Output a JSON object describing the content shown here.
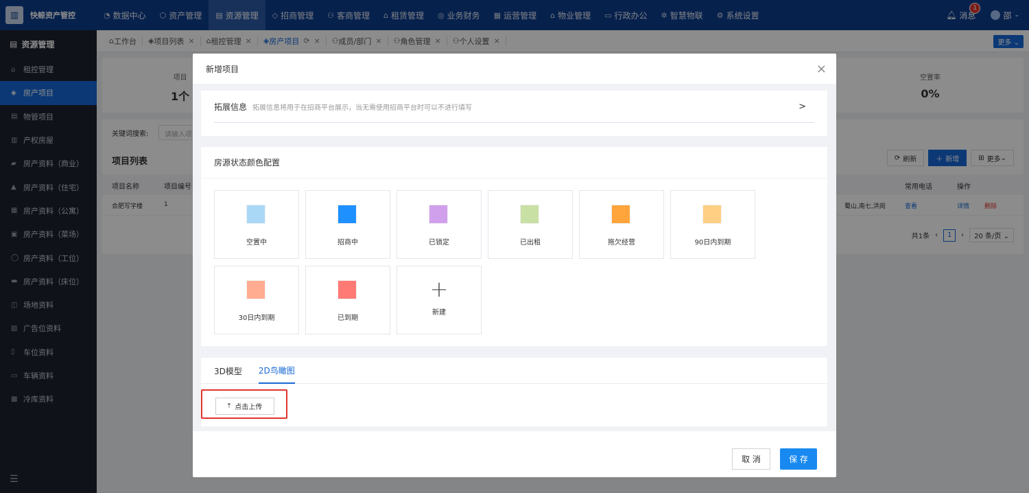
{
  "app": {
    "logo_glyph": "▥",
    "name": "快鲸资产管控"
  },
  "topnav": [
    {
      "icon": "◔",
      "label": "数据中心"
    },
    {
      "icon": "⬡",
      "label": "资产管理"
    },
    {
      "icon": "▤",
      "label": "资源管理",
      "active": true
    },
    {
      "icon": "◇",
      "label": "招商管理"
    },
    {
      "icon": "⚇",
      "label": "客商管理"
    },
    {
      "icon": "⌂",
      "label": "租赁管理"
    },
    {
      "icon": "◎",
      "label": "业务财务"
    },
    {
      "icon": "▦",
      "label": "运营管理"
    },
    {
      "icon": "⌂",
      "label": "物业管理"
    },
    {
      "icon": "▭",
      "label": "行政办公"
    },
    {
      "icon": "✲",
      "label": "智慧物联"
    },
    {
      "icon": "⚙",
      "label": "系统设置"
    }
  ],
  "header_right": {
    "messages_label": "消息",
    "messages_badge": "1",
    "user_name": "邵"
  },
  "sidebar": {
    "title": "资源管理",
    "items": [
      {
        "label": "租控管理"
      },
      {
        "label": "房产项目",
        "active": true
      },
      {
        "label": "物管项目"
      },
      {
        "label": "产权房屋"
      },
      {
        "label": "房产资料（商业）"
      },
      {
        "label": "房产资料（住宅）"
      },
      {
        "label": "房产资料（公寓）"
      },
      {
        "label": "房产资料（菜场）"
      },
      {
        "label": "房产资料（工位）"
      },
      {
        "label": "房产资料（床位）"
      },
      {
        "label": "场地资料"
      },
      {
        "label": "广告位资料"
      },
      {
        "label": "车位资料"
      },
      {
        "label": "车辆资料"
      },
      {
        "label": "冷库资料"
      }
    ]
  },
  "tabs": [
    {
      "label": "工作台",
      "closable": false
    },
    {
      "label": "项目列表",
      "closable": true
    },
    {
      "label": "租控管理",
      "closable": true
    },
    {
      "label": "房产项目",
      "closable": true,
      "active": true
    },
    {
      "label": "成员/部门",
      "closable": true
    },
    {
      "label": "角色管理",
      "closable": true
    },
    {
      "label": "个人设置",
      "closable": true
    }
  ],
  "more_label": "更多",
  "background": {
    "stat_left_label": "项目",
    "stat_left_value": "1个",
    "stat_right_label": "空置率",
    "stat_right_value": "0%",
    "keyword_label": "关键词搜索:",
    "keyword_placeholder": "请输入项",
    "list_title": "项目列表",
    "btn_refresh": "刷新",
    "btn_add": "新增",
    "btn_more": "更多",
    "col_name": "项目名称",
    "col_code": "项目编号",
    "col_phone": "常用电话",
    "col_ops": "操作",
    "row_name": "合肥写字楼",
    "row_code": "1",
    "row_addr": "蜀山,南七,洪岗",
    "row_view": "查看",
    "row_detail": "详情",
    "row_delete": "删除",
    "total": "共1条",
    "page": "1",
    "page_size": "20 条/页"
  },
  "modal": {
    "title": "新增项目",
    "ext_title": "拓展信息",
    "ext_desc": "拓展信息将用于在招商平台展示，当无需使用招商平台时可以不进行填写",
    "colors_title": "房源状态颜色配置",
    "statuses": [
      {
        "label": "空置中",
        "color": "#a9d8f7"
      },
      {
        "label": "招商中",
        "color": "#1e90ff"
      },
      {
        "label": "已锁定",
        "color": "#d1a0ec"
      },
      {
        "label": "已出租",
        "color": "#c9e0a4"
      },
      {
        "label": "拖欠经营",
        "color": "#ffa53c"
      },
      {
        "label": "90日内到期",
        "color": "#ffcf83"
      },
      {
        "label": "30日内到期",
        "color": "#ffac90"
      },
      {
        "label": "已到期",
        "color": "#ff7a75"
      }
    ],
    "new_label": "新建",
    "media_tabs": [
      "3D模型",
      "2D鸟瞰图"
    ],
    "upload_label": "点击上传",
    "cancel": "取 消",
    "save": "保 存"
  }
}
